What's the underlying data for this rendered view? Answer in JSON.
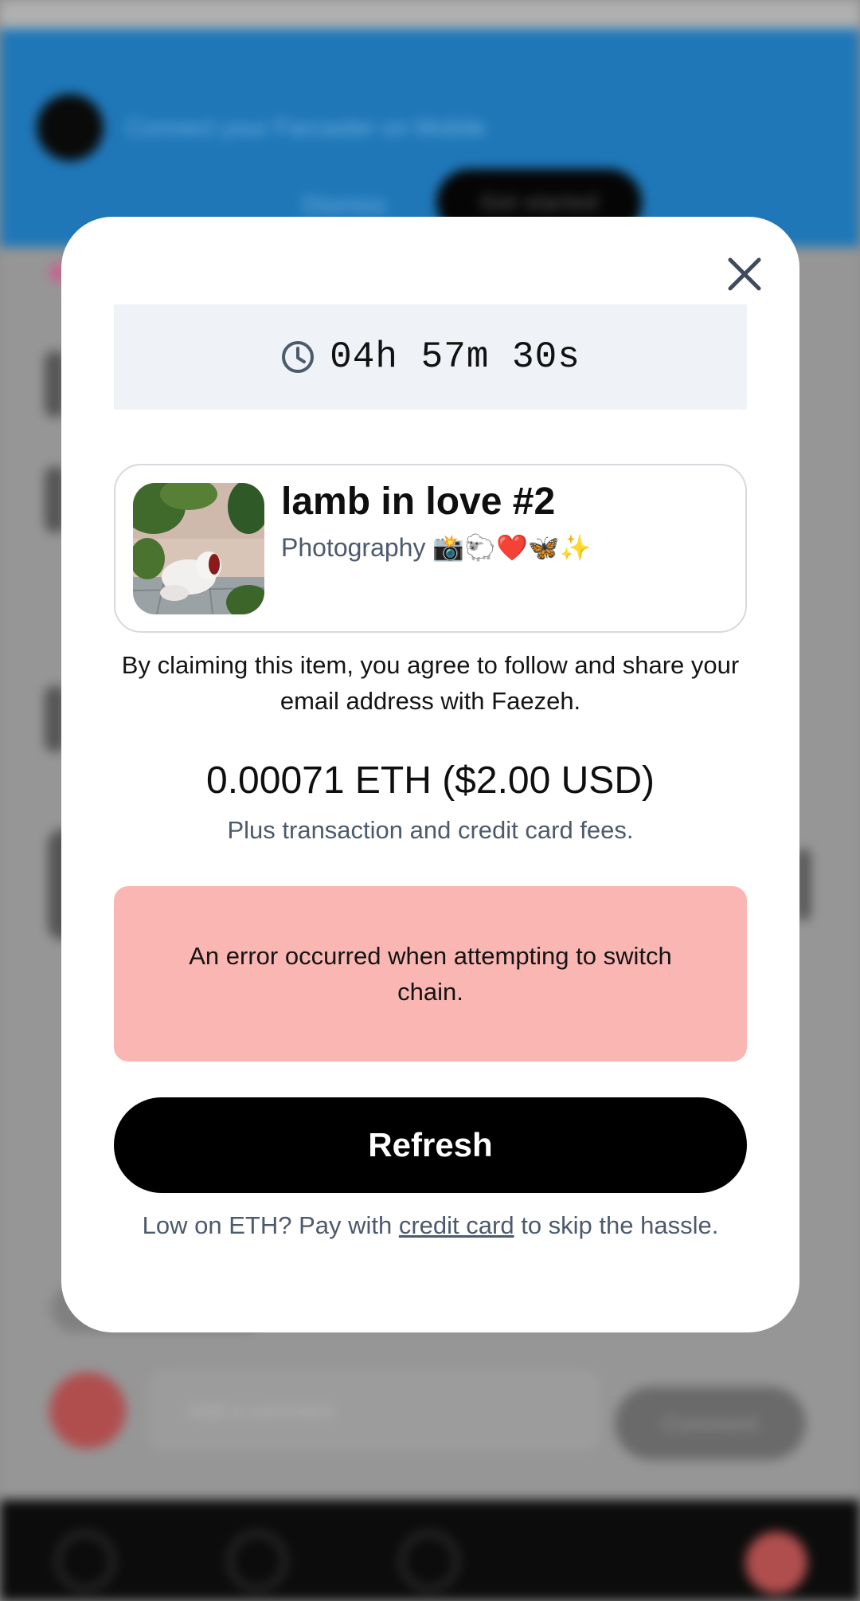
{
  "background": {
    "banner_text": "Connect your Farcaster on Mobile",
    "banner_dismiss": "Dismiss",
    "banner_cta": "Get started",
    "composer_placeholder": "Add a comment",
    "composer_button": "Comment"
  },
  "modal": {
    "timer": {
      "icon": "clock-icon",
      "value": "04h 57m 30s"
    },
    "item": {
      "title": "lamb in love #2",
      "subtitle": "Photography 📸🐑❤️🦋✨"
    },
    "agreement": "By claiming this item, you agree to follow and share your email address with Faezeh.",
    "price": "0.00071 ETH ($2.00 USD)",
    "fees_note": "Plus transaction and credit card fees.",
    "error_message": "An error occurred when attempting to switch chain.",
    "refresh_label": "Refresh",
    "footer": {
      "before": "Low on ETH? Pay with ",
      "link": "credit card",
      "after": " to skip the hassle."
    }
  },
  "colors": {
    "banner": "#1f77b8",
    "timer_bg": "#eff2f7",
    "error_bg": "#fab6b2",
    "button_bg": "#000000",
    "muted_text": "#4d5a6c"
  }
}
